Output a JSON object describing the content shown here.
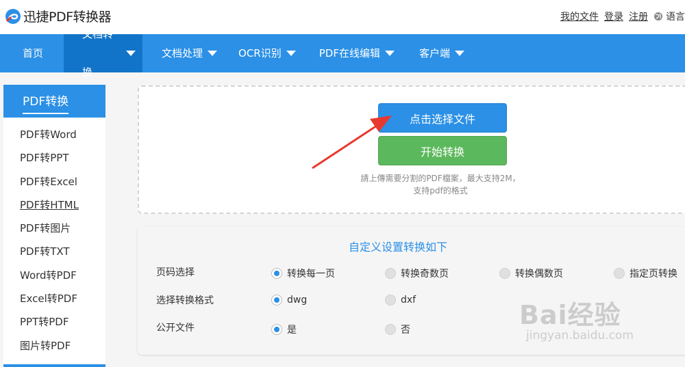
{
  "app": {
    "title": "迅捷PDF转换器"
  },
  "top_links": {
    "my_files": "我的文件",
    "login": "登录",
    "register": "注册",
    "language": "语言"
  },
  "nav": {
    "items": [
      {
        "label": "首页"
      },
      {
        "label": "文档转换"
      },
      {
        "label": "文档处理"
      },
      {
        "label": "OCR识别"
      },
      {
        "label": "PDF在线编辑"
      },
      {
        "label": "客户端"
      }
    ]
  },
  "sidebar": {
    "title": "PDF转换",
    "items": [
      {
        "label": "PDF转Word"
      },
      {
        "label": "PDF转PPT"
      },
      {
        "label": "PDF转Excel"
      },
      {
        "label": "PDF转HTML"
      },
      {
        "label": "PDF转图片"
      },
      {
        "label": "PDF转TXT"
      },
      {
        "label": "Word转PDF"
      },
      {
        "label": "Excel转PDF"
      },
      {
        "label": "PPT转PDF"
      },
      {
        "label": "图片转PDF"
      }
    ]
  },
  "upload": {
    "select_label": "点击选择文件",
    "start_label": "开始转换",
    "hint_line1": "請上傳需要分割的PDF檔案，最大支持2M，",
    "hint_line2": "支持pdf的格式"
  },
  "settings": {
    "title": "自定义设置转换如下",
    "page_label": "页码选择",
    "page_options": [
      "转换每一页",
      "转换奇数页",
      "转换偶数页",
      "指定页转换"
    ],
    "page_selected": "转换每一页",
    "format_label": "选择转换格式",
    "format_options": [
      "dwg",
      "dxf"
    ],
    "format_selected": "dwg",
    "public_label": "公开文件",
    "public_options": [
      "是",
      "否"
    ],
    "public_selected": "是"
  },
  "watermark": {
    "main": "Bai经验",
    "sub": "jingyan.baidu.com"
  },
  "colors": {
    "primary": "#2b90e6",
    "nav_active": "#1274c8",
    "start": "#5cb85c",
    "arrow": "#e8392f"
  }
}
